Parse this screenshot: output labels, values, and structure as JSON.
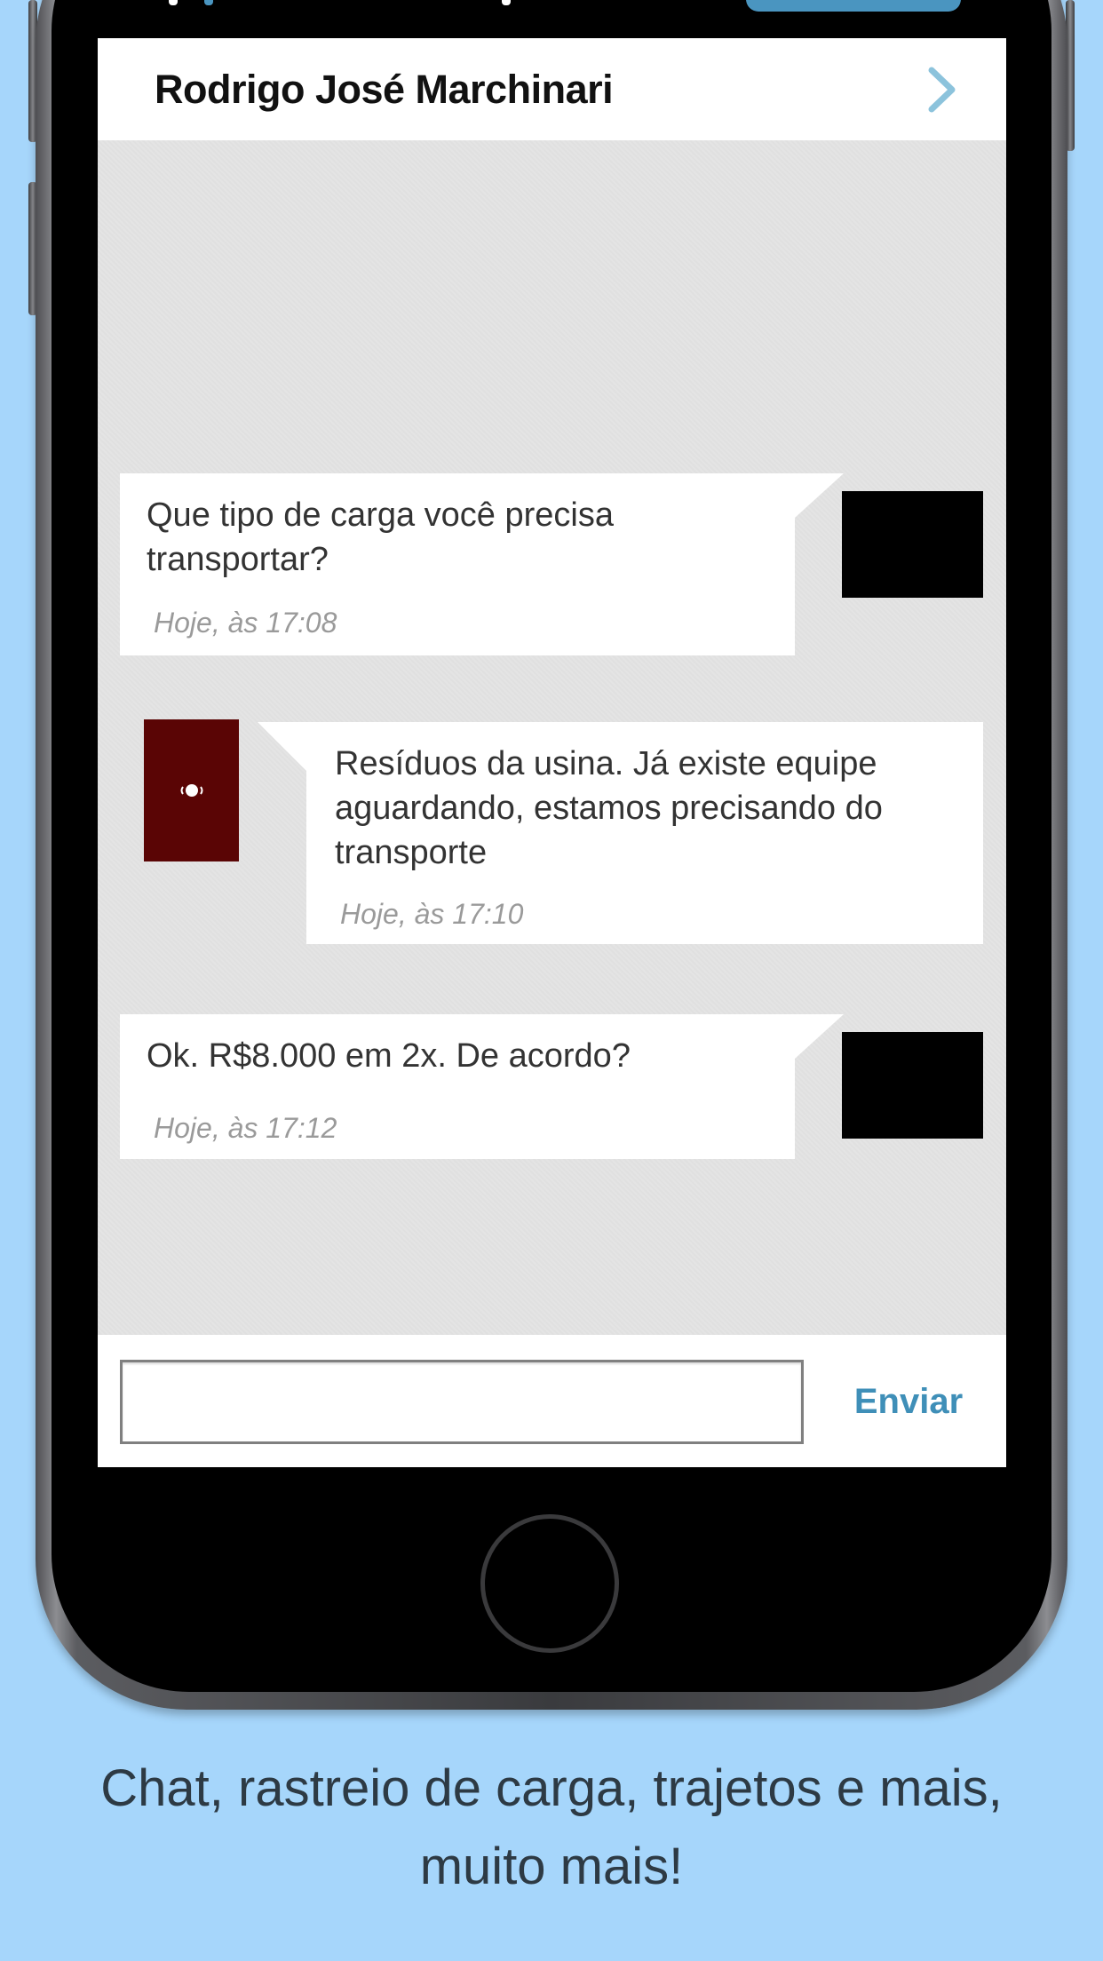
{
  "chat": {
    "contact_name": "Rodrigo José Marchinari",
    "messages": [
      {
        "text": "Que tipo de carga você precisa transportar?",
        "time": "Hoje, às 17:08",
        "side": "left"
      },
      {
        "text": "Resíduos da usina. Já existe equipe aguardando, estamos precisando do transporte",
        "time": "Hoje, às 17:10",
        "side": "right"
      },
      {
        "text": "Ok. R$8.000 em 2x. De acordo?",
        "time": "Hoje, às 17:12",
        "side": "left"
      }
    ],
    "composer": {
      "input_value": "",
      "placeholder": "",
      "send_label": "Enviar"
    }
  },
  "caption": "Chat, rastreio de carga, trajetos e mais, muito mais!",
  "colors": {
    "background": "#a6d6fb",
    "accent": "#3f8fb8",
    "chevron": "#8cc3dc",
    "avatar_dark_red": "#5a0505"
  },
  "icons": {
    "header_chevron": "chevron-right-icon",
    "avatar_logo": "logo-icon"
  }
}
